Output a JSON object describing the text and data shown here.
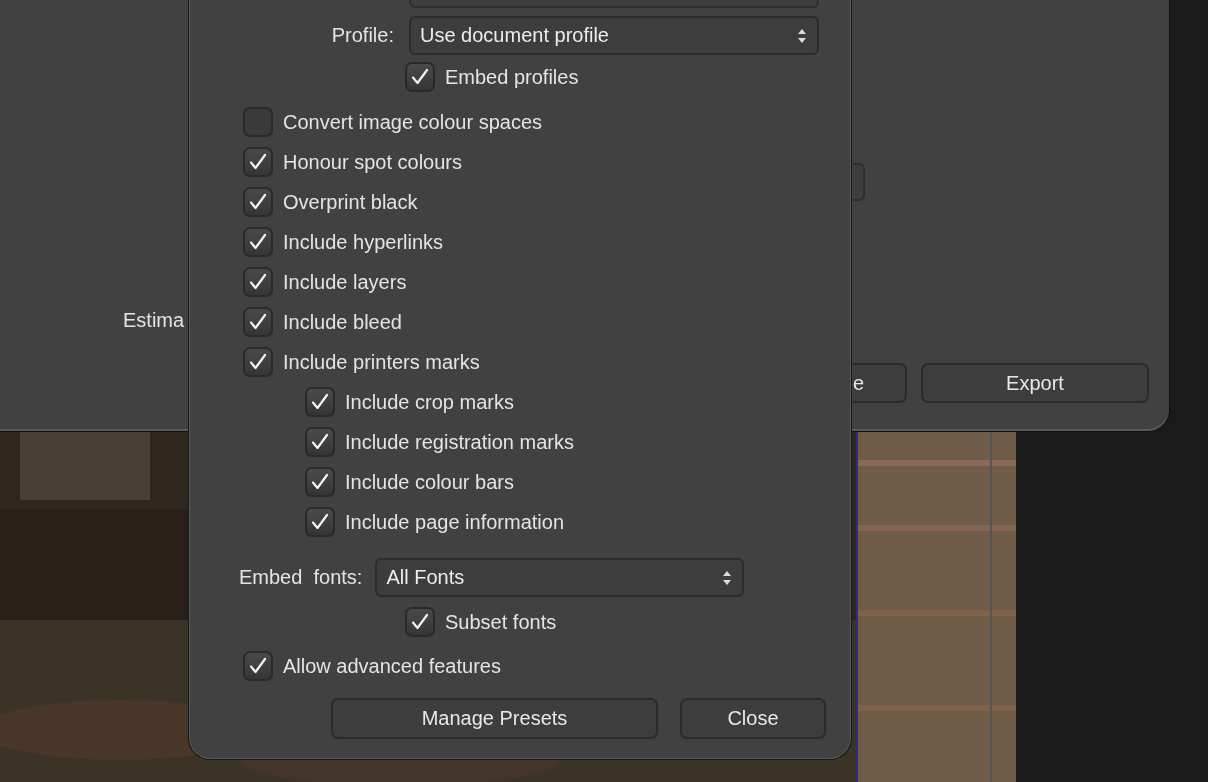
{
  "back_dialog": {
    "estimate_label": "Estima",
    "buttons": [
      {
        "label": "e"
      },
      {
        "label": "Export"
      }
    ]
  },
  "export_options": {
    "profile": {
      "label": "Profile:",
      "value": "Use document profile"
    },
    "embed_profiles": {
      "label": "Embed profiles",
      "checked": true
    },
    "options": [
      {
        "label": "Convert image colour spaces",
        "checked": false
      },
      {
        "label": "Honour spot colours",
        "checked": true
      },
      {
        "label": "Overprint black",
        "checked": true
      },
      {
        "label": "Include hyperlinks",
        "checked": true
      },
      {
        "label": "Include layers",
        "checked": true
      },
      {
        "label": "Include bleed",
        "checked": true
      },
      {
        "label": "Include printers marks",
        "checked": true,
        "children": [
          {
            "label": "Include crop marks",
            "checked": true
          },
          {
            "label": "Include registration marks",
            "checked": true
          },
          {
            "label": "Include colour bars",
            "checked": true
          },
          {
            "label": "Include page information",
            "checked": true
          }
        ]
      }
    ],
    "embed_fonts": {
      "label": "Embed  fonts:",
      "value": "All Fonts"
    },
    "subset_fonts": {
      "label": "Subset fonts",
      "checked": true
    },
    "allow_advanced": {
      "label": "Allow advanced features",
      "checked": true
    },
    "buttons": [
      {
        "label": "Manage Presets"
      },
      {
        "label": "Close"
      }
    ]
  }
}
